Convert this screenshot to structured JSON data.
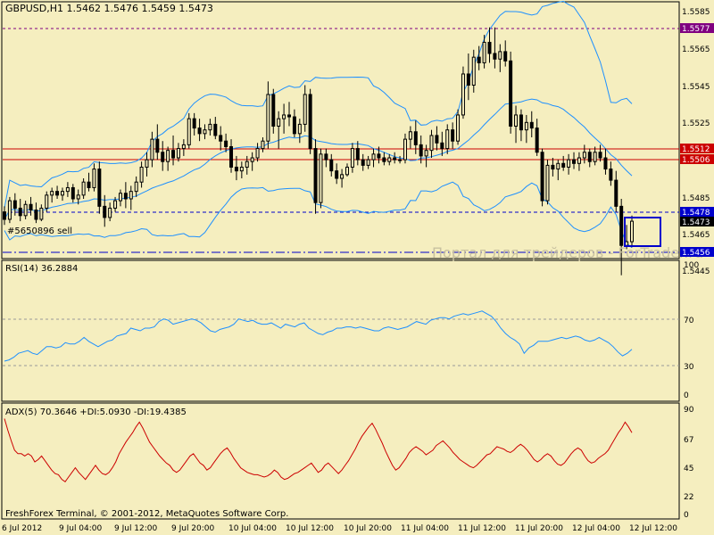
{
  "colors": {
    "background": "#f5eebf",
    "frame": "#000000",
    "candles": "#000000",
    "bollinger": "#1e90ff",
    "rsi_line": "#1e90ff",
    "adx_line": "#cc0000",
    "di_lines": "#e8dcb0",
    "red_levels": "#cc0000",
    "blue_levels": "#0000cc",
    "top_level": "#800080",
    "grid": "#d8cfa0"
  },
  "main": {
    "header": "GBPUSD,H1  1.5462 1.5476 1.5459 1.5473",
    "order_label": "#5650896 sell",
    "watermark": "Портал для трейдеров - ForTrader.ru",
    "price_ticks": [
      "1.5585",
      "1.5565",
      "1.5545",
      "1.5525",
      "1.5485",
      "1.5465",
      "1.5445"
    ],
    "level_labels": [
      {
        "text": "1.5577",
        "color": "#800080",
        "value": 1.5577
      },
      {
        "text": "1.5512",
        "color": "#cc0000",
        "value": 1.5512
      },
      {
        "text": "1.5506",
        "color": "#cc0000",
        "value": 1.5506
      },
      {
        "text": "1.5478",
        "color": "#0000cc",
        "value": 1.5478
      },
      {
        "text": "1.5473",
        "color": "#000000",
        "value": 1.5473
      },
      {
        "text": "1.5456",
        "color": "#0000cc",
        "value": 1.5456
      }
    ]
  },
  "rsi": {
    "header": "RSI(14) 36.2884",
    "ticks": [
      "100",
      "70",
      "30",
      "0"
    ]
  },
  "adx": {
    "header": "ADX(5) 70.3646 +DI:5.0930 -DI:19.4385",
    "ticks": [
      "90",
      "67",
      "45",
      "22",
      "0"
    ]
  },
  "time_ticks": [
    "6 Jul 2012",
    "9 Jul 04:00",
    "9 Jul 12:00",
    "9 Jul 20:00",
    "10 Jul 04:00",
    "10 Jul 12:00",
    "10 Jul 20:00",
    "11 Jul 04:00",
    "11 Jul 12:00",
    "11 Jul 20:00",
    "12 Jul 04:00",
    "12 Jul 12:00"
  ],
  "footer": "FreshForex Terminal, © 2001-2012, MetaQuotes Software Corp.",
  "chart_data": [
    {
      "type": "candlestick",
      "title": "GBPUSD,H1",
      "ylim": [
        1.544,
        1.559
      ],
      "bars": [
        [
          1.5478,
          1.5481,
          1.5471,
          1.5474
        ],
        [
          1.5474,
          1.5486,
          1.5472,
          1.5484
        ],
        [
          1.5484,
          1.5488,
          1.5476,
          1.548
        ],
        [
          1.548,
          1.5485,
          1.5473,
          1.5476
        ],
        [
          1.5476,
          1.5484,
          1.5474,
          1.5482
        ],
        [
          1.5482,
          1.5486,
          1.5476,
          1.5479
        ],
        [
          1.5479,
          1.5483,
          1.5472,
          1.5474
        ],
        [
          1.5474,
          1.5482,
          1.5473,
          1.548
        ],
        [
          1.548,
          1.5489,
          1.5478,
          1.5487
        ],
        [
          1.5487,
          1.5491,
          1.5483,
          1.5489
        ],
        [
          1.5489,
          1.5492,
          1.5485,
          1.5487
        ],
        [
          1.5487,
          1.5491,
          1.5484,
          1.5489
        ],
        [
          1.5489,
          1.5494,
          1.5486,
          1.5491
        ],
        [
          1.5491,
          1.5493,
          1.5483,
          1.5485
        ],
        [
          1.5485,
          1.549,
          1.5482,
          1.5487
        ],
        [
          1.5487,
          1.5496,
          1.5485,
          1.5494
        ],
        [
          1.5494,
          1.5499,
          1.5489,
          1.5491
        ],
        [
          1.5491,
          1.5504,
          1.5489,
          1.5501
        ],
        [
          1.5501,
          1.5505,
          1.5477,
          1.5481
        ],
        [
          1.5481,
          1.5487,
          1.547,
          1.5475
        ],
        [
          1.5475,
          1.5483,
          1.5473,
          1.548
        ],
        [
          1.548,
          1.5486,
          1.5478,
          1.5484
        ],
        [
          1.5484,
          1.549,
          1.5481,
          1.5488
        ],
        [
          1.5488,
          1.5494,
          1.548,
          1.5485
        ],
        [
          1.5485,
          1.5492,
          1.5479,
          1.5489
        ],
        [
          1.5489,
          1.5497,
          1.5486,
          1.5494
        ],
        [
          1.5494,
          1.5505,
          1.5491,
          1.5502
        ],
        [
          1.5502,
          1.551,
          1.5497,
          1.5506
        ],
        [
          1.5506,
          1.5521,
          1.5502,
          1.5517
        ],
        [
          1.5517,
          1.5525,
          1.5506,
          1.551
        ],
        [
          1.551,
          1.5516,
          1.55,
          1.5505
        ],
        [
          1.5505,
          1.5513,
          1.55,
          1.5511
        ],
        [
          1.5511,
          1.5519,
          1.5503,
          1.5507
        ],
        [
          1.5507,
          1.5515,
          1.5505,
          1.5512
        ],
        [
          1.5512,
          1.5517,
          1.5508,
          1.5514
        ],
        [
          1.5514,
          1.5531,
          1.5512,
          1.5528
        ],
        [
          1.5528,
          1.5531,
          1.5519,
          1.5523
        ],
        [
          1.5523,
          1.5528,
          1.5516,
          1.552
        ],
        [
          1.552,
          1.5525,
          1.5517,
          1.5522
        ],
        [
          1.5522,
          1.5528,
          1.5519,
          1.5525
        ],
        [
          1.5525,
          1.5529,
          1.5517,
          1.5519
        ],
        [
          1.5519,
          1.5524,
          1.5511,
          1.5516
        ],
        [
          1.5516,
          1.552,
          1.551,
          1.5513
        ],
        [
          1.5513,
          1.5517,
          1.5499,
          1.5502
        ],
        [
          1.5502,
          1.5508,
          1.5495,
          1.55
        ],
        [
          1.55,
          1.5505,
          1.5496,
          1.5502
        ],
        [
          1.5502,
          1.5508,
          1.5498,
          1.5505
        ],
        [
          1.5505,
          1.551,
          1.55,
          1.5507
        ],
        [
          1.5507,
          1.5515,
          1.5505,
          1.5512
        ],
        [
          1.5512,
          1.5518,
          1.551,
          1.5516
        ],
        [
          1.5516,
          1.5548,
          1.5512,
          1.5541
        ],
        [
          1.5541,
          1.5544,
          1.552,
          1.5524
        ],
        [
          1.5524,
          1.5532,
          1.5512,
          1.5528
        ],
        [
          1.5528,
          1.5536,
          1.552,
          1.553
        ],
        [
          1.553,
          1.5537,
          1.5524,
          1.5529
        ],
        [
          1.5529,
          1.5533,
          1.5518,
          1.552
        ],
        [
          1.552,
          1.5528,
          1.5515,
          1.5525
        ],
        [
          1.5525,
          1.5546,
          1.5521,
          1.5541
        ],
        [
          1.5541,
          1.5544,
          1.5509,
          1.5512
        ],
        [
          1.5512,
          1.5517,
          1.5477,
          1.5483
        ],
        [
          1.5483,
          1.5512,
          1.548,
          1.5509
        ],
        [
          1.5509,
          1.5512,
          1.5502,
          1.5506
        ],
        [
          1.5506,
          1.5509,
          1.5497,
          1.55
        ],
        [
          1.55,
          1.5504,
          1.5493,
          1.5496
        ],
        [
          1.5496,
          1.5501,
          1.5491,
          1.5498
        ],
        [
          1.5498,
          1.5504,
          1.5497,
          1.5502
        ],
        [
          1.5502,
          1.5515,
          1.5499,
          1.5512
        ],
        [
          1.5512,
          1.5516,
          1.5503,
          1.5506
        ],
        [
          1.5506,
          1.5509,
          1.55,
          1.5503
        ],
        [
          1.5503,
          1.5508,
          1.5501,
          1.5506
        ],
        [
          1.5506,
          1.5512,
          1.5502,
          1.5509
        ],
        [
          1.5509,
          1.5513,
          1.5504,
          1.5507
        ],
        [
          1.5507,
          1.551,
          1.5503,
          1.5505
        ],
        [
          1.5505,
          1.5509,
          1.5503,
          1.5507
        ],
        [
          1.5507,
          1.551,
          1.5504,
          1.5506
        ],
        [
          1.5506,
          1.5508,
          1.5504,
          1.5506
        ],
        [
          1.5506,
          1.552,
          1.5504,
          1.5517
        ],
        [
          1.5517,
          1.5524,
          1.5512,
          1.5521
        ],
        [
          1.5521,
          1.5527,
          1.5509,
          1.5514
        ],
        [
          1.5514,
          1.5519,
          1.5504,
          1.5508
        ],
        [
          1.5508,
          1.5514,
          1.5502,
          1.5511
        ],
        [
          1.5511,
          1.5522,
          1.5507,
          1.5519
        ],
        [
          1.5519,
          1.5524,
          1.5511,
          1.5515
        ],
        [
          1.5515,
          1.5521,
          1.5508,
          1.5512
        ],
        [
          1.5512,
          1.5525,
          1.5509,
          1.5522
        ],
        [
          1.5522,
          1.5526,
          1.5512,
          1.5516
        ],
        [
          1.5516,
          1.5533,
          1.5514,
          1.553
        ],
        [
          1.553,
          1.5556,
          1.5528,
          1.5552
        ],
        [
          1.5552,
          1.5563,
          1.5538,
          1.5546
        ],
        [
          1.5546,
          1.5565,
          1.5542,
          1.5561
        ],
        [
          1.5561,
          1.5567,
          1.5554,
          1.5558
        ],
        [
          1.5558,
          1.5573,
          1.5555,
          1.5569
        ],
        [
          1.5569,
          1.5577,
          1.5558,
          1.5563
        ],
        [
          1.5563,
          1.5577,
          1.5555,
          1.556
        ],
        [
          1.556,
          1.5568,
          1.5553,
          1.5564
        ],
        [
          1.5564,
          1.557,
          1.5556,
          1.5559
        ],
        [
          1.5559,
          1.5564,
          1.552,
          1.5524
        ],
        [
          1.5524,
          1.5535,
          1.5515,
          1.553
        ],
        [
          1.553,
          1.5533,
          1.5516,
          1.5522
        ],
        [
          1.5522,
          1.553,
          1.5515,
          1.5526
        ],
        [
          1.5526,
          1.5532,
          1.5518,
          1.5523
        ],
        [
          1.5523,
          1.5528,
          1.5508,
          1.551
        ],
        [
          1.551,
          1.5512,
          1.5481,
          1.5484
        ],
        [
          1.5484,
          1.5506,
          1.5482,
          1.5503
        ],
        [
          1.5503,
          1.5507,
          1.5497,
          1.5501
        ],
        [
          1.5501,
          1.5506,
          1.5495,
          1.5504
        ],
        [
          1.5504,
          1.5508,
          1.55,
          1.5502
        ],
        [
          1.5502,
          1.5509,
          1.5498,
          1.5506
        ],
        [
          1.5506,
          1.551,
          1.5501,
          1.5504
        ],
        [
          1.5504,
          1.551,
          1.55,
          1.5507
        ],
        [
          1.5507,
          1.5514,
          1.5504,
          1.551
        ],
        [
          1.551,
          1.5512,
          1.5502,
          1.5505
        ],
        [
          1.5505,
          1.5513,
          1.5503,
          1.551
        ],
        [
          1.551,
          1.5514,
          1.5505,
          1.5507
        ],
        [
          1.5507,
          1.5512,
          1.5498,
          1.5501
        ],
        [
          1.5501,
          1.5505,
          1.5492,
          1.5495
        ],
        [
          1.5495,
          1.55,
          1.5478,
          1.5481
        ],
        [
          1.5481,
          1.5485,
          1.5444,
          1.546
        ],
        [
          1.546,
          1.5471,
          1.5458,
          1.5462
        ],
        [
          1.5462,
          1.5476,
          1.5459,
          1.5473
        ]
      ]
    },
    {
      "type": "line",
      "title": "RSI(14) 36.2884",
      "ylim": [
        0,
        100
      ],
      "series": [
        {
          "values": [
            27,
            28,
            30,
            33,
            34,
            35,
            33,
            32,
            35,
            38,
            38,
            37,
            38,
            41,
            40,
            40,
            42,
            45,
            42,
            40,
            38,
            40,
            42,
            43,
            46,
            47,
            48,
            52,
            51,
            50,
            52,
            52,
            53,
            57,
            59,
            58,
            55,
            56,
            57,
            58,
            59,
            58,
            56,
            53,
            50,
            49,
            51,
            52,
            53,
            55,
            59,
            58,
            57,
            58,
            56,
            55,
            55,
            56,
            54,
            52,
            55,
            54,
            53,
            55,
            56,
            52,
            50,
            48,
            47,
            49,
            50,
            52,
            52,
            53,
            53,
            52,
            53,
            52,
            51,
            50,
            50,
            52,
            53,
            52,
            51,
            52,
            53,
            55,
            57,
            56,
            55,
            58,
            59,
            60,
            60,
            59,
            61,
            62,
            63,
            62,
            63,
            64,
            65,
            63,
            61,
            57,
            52,
            48,
            45,
            43,
            40,
            33,
            37,
            39,
            42,
            42,
            42,
            43,
            44,
            45,
            44,
            45,
            46,
            45,
            43,
            42,
            43,
            45,
            43,
            41,
            38,
            34,
            31,
            33,
            36
          ]
        }
      ]
    },
    {
      "type": "line",
      "title": "ADX(5) 70.3646 +DI:5.0930 -DI:19.4385",
      "ylim": [
        0,
        90
      ],
      "series": [
        {
          "values": [
            82,
            72,
            63,
            55,
            52,
            52,
            50,
            52,
            50,
            45,
            47,
            50,
            46,
            42,
            38,
            35,
            34,
            30,
            28,
            32,
            36,
            40,
            36,
            33,
            30,
            34,
            38,
            42,
            38,
            35,
            34,
            36,
            40,
            45,
            52,
            57,
            62,
            66,
            70,
            75,
            79,
            74,
            68,
            62,
            58,
            54,
            50,
            47,
            44,
            42,
            38,
            36,
            38,
            42,
            46,
            50,
            52,
            48,
            44,
            42,
            38,
            40,
            44,
            48,
            52,
            55,
            57,
            53,
            48,
            44,
            40,
            38,
            36,
            35,
            34,
            34,
            33,
            32,
            33,
            35,
            38,
            36,
            32,
            30,
            31,
            33,
            35,
            36,
            38,
            40,
            42,
            44,
            40,
            36,
            38,
            42,
            44,
            41,
            38,
            35,
            38,
            42,
            46,
            51,
            56,
            62,
            67,
            71,
            75,
            78,
            73,
            67,
            61,
            54,
            48,
            42,
            38,
            40,
            44,
            48,
            53,
            56,
            58,
            56,
            54,
            51,
            53,
            55,
            59,
            61,
            63,
            60,
            57,
            53,
            50,
            47,
            45,
            43,
            41,
            40,
            42,
            45,
            48,
            51,
            52,
            55,
            58,
            57,
            56,
            54,
            53,
            55,
            58,
            60,
            58,
            55,
            51,
            47,
            45,
            47,
            50,
            52,
            50,
            46,
            43,
            42,
            44,
            48,
            52,
            55,
            57,
            55,
            50,
            46,
            44,
            45,
            48,
            50,
            52,
            55,
            60,
            65,
            70,
            74,
            79,
            75,
            70
          ]
        }
      ]
    }
  ]
}
